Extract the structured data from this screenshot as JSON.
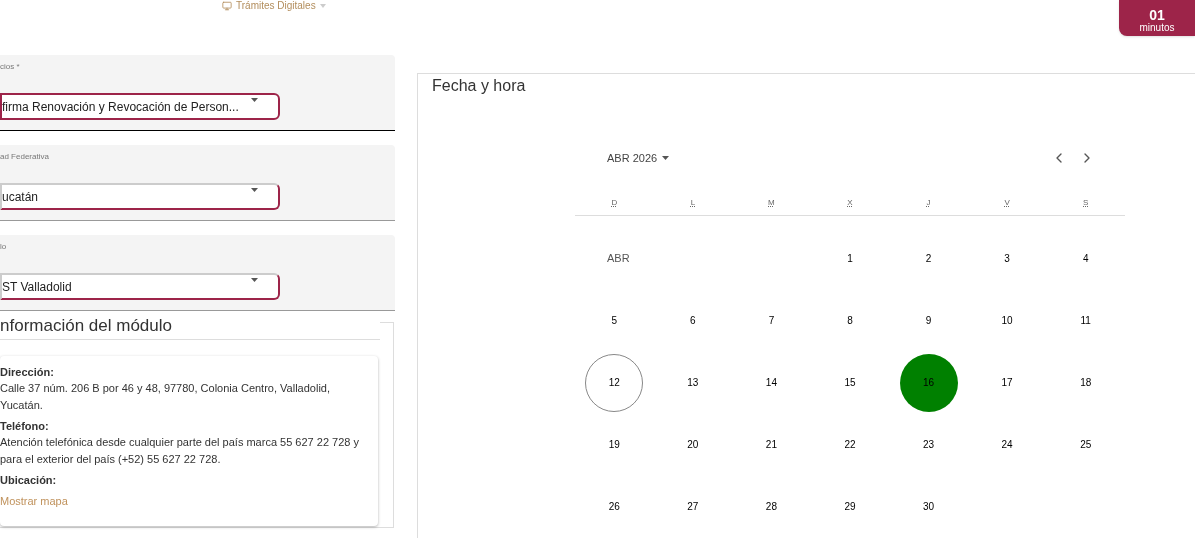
{
  "header": {
    "menu_label": "Trámites Digitales",
    "timer": {
      "value": "01",
      "unit": "minutos"
    }
  },
  "fields": [
    {
      "label": "cios *",
      "value": "firma Renovación y Revocación de Person...",
      "focused": true
    },
    {
      "label": "ad Federativa",
      "value": "ucatán",
      "focused": false
    },
    {
      "label": "lo",
      "value": "ST Valladolid",
      "focused": false
    }
  ],
  "module_info": {
    "title": "nformación del módulo",
    "items": [
      {
        "kind": "text",
        "label": "Dirección:",
        "value": "Calle 37 núm. 206 B por 46 y 48, 97780, Colonia Centro, Valladolid, Yucatán."
      },
      {
        "kind": "text",
        "label": "Teléfono:",
        "value": "Atención telefónica desde cualquier parte del país marca 55 627 22 728 y para el exterior del país (+52) 55 627 22 728."
      },
      {
        "kind": "link",
        "label": "Ubicación:",
        "value": "Mostrar mapa"
      }
    ]
  },
  "calendar": {
    "title": "Fecha y hora",
    "month_label": "ABR 2026",
    "weekdays": [
      "D",
      "L",
      "M",
      "X",
      "J",
      "V",
      "S"
    ],
    "weeks": [
      [
        {
          "kind": "month",
          "text": "ABR"
        },
        {
          "kind": "empty"
        },
        {
          "kind": "empty"
        },
        {
          "kind": "day",
          "text": "1",
          "today": false,
          "selected": false
        },
        {
          "kind": "day",
          "text": "2",
          "today": false,
          "selected": false
        },
        {
          "kind": "day",
          "text": "3",
          "today": false,
          "selected": false
        },
        {
          "kind": "day",
          "text": "4",
          "today": false,
          "selected": false
        }
      ],
      [
        {
          "kind": "day",
          "text": "5",
          "today": false,
          "selected": false
        },
        {
          "kind": "day",
          "text": "6",
          "today": false,
          "selected": false
        },
        {
          "kind": "day",
          "text": "7",
          "today": false,
          "selected": false
        },
        {
          "kind": "day",
          "text": "8",
          "today": false,
          "selected": false
        },
        {
          "kind": "day",
          "text": "9",
          "today": false,
          "selected": false
        },
        {
          "kind": "day",
          "text": "10",
          "today": false,
          "selected": false
        },
        {
          "kind": "day",
          "text": "11",
          "today": false,
          "selected": false
        }
      ],
      [
        {
          "kind": "day",
          "text": "12",
          "today": true,
          "selected": false
        },
        {
          "kind": "day",
          "text": "13",
          "today": false,
          "selected": false
        },
        {
          "kind": "day",
          "text": "14",
          "today": false,
          "selected": false
        },
        {
          "kind": "day",
          "text": "15",
          "today": false,
          "selected": false
        },
        {
          "kind": "day",
          "text": "16",
          "today": false,
          "selected": true
        },
        {
          "kind": "day",
          "text": "17",
          "today": false,
          "selected": false
        },
        {
          "kind": "day",
          "text": "18",
          "today": false,
          "selected": false
        }
      ],
      [
        {
          "kind": "day",
          "text": "19",
          "today": false,
          "selected": false
        },
        {
          "kind": "day",
          "text": "20",
          "today": false,
          "selected": false
        },
        {
          "kind": "day",
          "text": "21",
          "today": false,
          "selected": false
        },
        {
          "kind": "day",
          "text": "22",
          "today": false,
          "selected": false
        },
        {
          "kind": "day",
          "text": "23",
          "today": false,
          "selected": false
        },
        {
          "kind": "day",
          "text": "24",
          "today": false,
          "selected": false
        },
        {
          "kind": "day",
          "text": "25",
          "today": false,
          "selected": false
        }
      ],
      [
        {
          "kind": "day",
          "text": "26",
          "today": false,
          "selected": false
        },
        {
          "kind": "day",
          "text": "27",
          "today": false,
          "selected": false
        },
        {
          "kind": "day",
          "text": "28",
          "today": false,
          "selected": false
        },
        {
          "kind": "day",
          "text": "29",
          "today": false,
          "selected": false
        },
        {
          "kind": "day",
          "text": "30",
          "today": false,
          "selected": false
        }
      ]
    ]
  }
}
